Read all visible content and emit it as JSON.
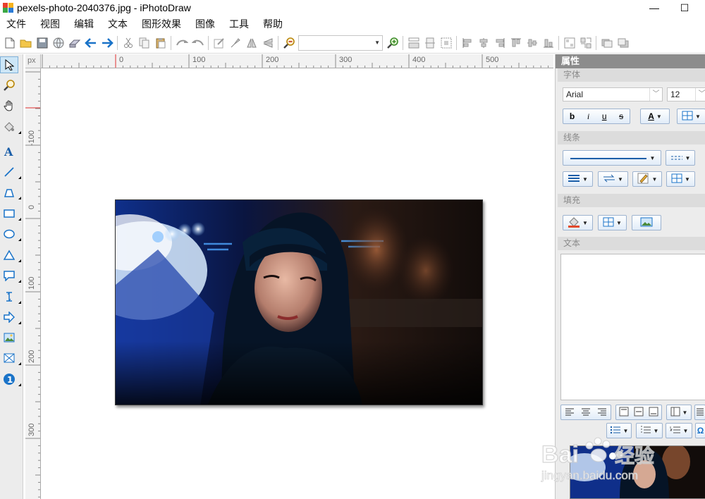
{
  "window": {
    "title": "pexels-photo-2040376.jpg - iPhotoDraw",
    "min_symbol": "—",
    "max_symbol": "☐"
  },
  "menu": [
    "文件",
    "视图",
    "编辑",
    "文本",
    "图形效果",
    "图像",
    "工具",
    "帮助"
  ],
  "toolbar": {
    "zoom_value": ""
  },
  "ruler": {
    "unit": "px",
    "h_labels": [
      "0",
      "100",
      "200",
      "300",
      "400",
      "500"
    ],
    "v_labels": [
      "-100",
      "0",
      "100",
      "200",
      "300"
    ]
  },
  "panel": {
    "title": "属性",
    "font_section": "字体",
    "font_name": "Arial",
    "font_size": "12",
    "bold": "b",
    "italic": "i",
    "underline": "u",
    "strike": "s",
    "font_color_glyph": "A",
    "line_section": "线条",
    "fill_section": "填充",
    "text_section": "文本"
  },
  "watermark": {
    "brand": "Bai",
    "brand2": "经验",
    "url": "jingyan.baidu.com"
  },
  "colors": {
    "accent": "#1a73c8",
    "panel_header": "#8c8c8c",
    "ruler_marker": "#e03030"
  }
}
